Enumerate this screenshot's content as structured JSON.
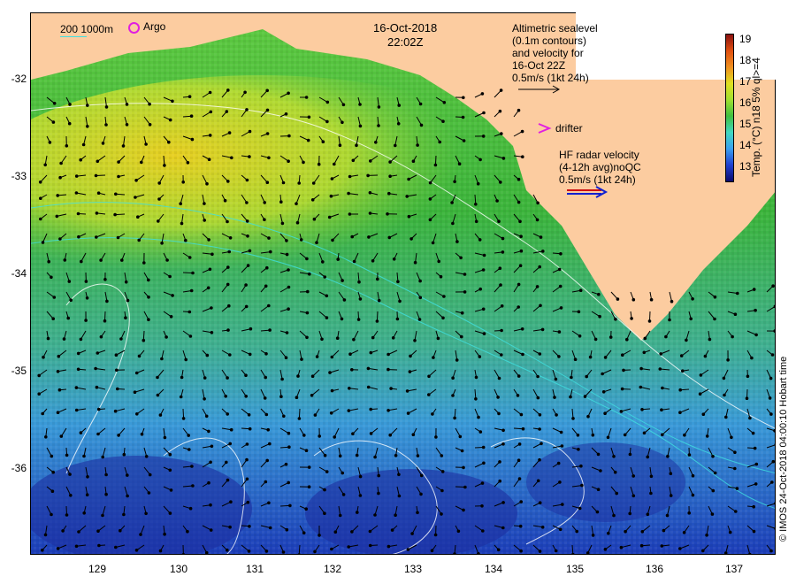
{
  "map": {
    "date": "16-Oct-2018",
    "time": "22:02Z",
    "contour_legend": "200  1000m",
    "argo_label": "Argo",
    "altimetry_label": [
      "Altimetric sealevel",
      "(0.1m contours)",
      "and velocity for",
      "16-Oct 22Z",
      "0.5m/s (1kt 24h)"
    ],
    "drifter_label": "drifter",
    "hf_radar_label": [
      "HF radar velocity",
      "(4-12h avg)noQC",
      "0.5m/s (1kt 24h)"
    ],
    "credit": "© IMOS 24-Oct-2018 04:00:10 Hobart time",
    "lat_ticks": [
      "-32",
      "-33",
      "-34",
      "-35",
      "-36"
    ],
    "lon_ticks": [
      "129",
      "130",
      "131",
      "132",
      "133",
      "134",
      "135",
      "136",
      "137"
    ],
    "land_color": "#fccca0",
    "argo_color": "#e020e0",
    "contour_color": "#40e0e0"
  },
  "colorbar": {
    "label": "Temp. (°C) n18 5% ql>=4",
    "ticks": [
      "19",
      "18",
      "17",
      "16",
      "15",
      "14",
      "13"
    ],
    "colors": [
      "#0a0a6e",
      "#1f3fd0",
      "#3aa0f0",
      "#40d8c0",
      "#40c040",
      "#a0e030",
      "#e0e020",
      "#f09020",
      "#e05010",
      "#8a1010"
    ]
  }
}
